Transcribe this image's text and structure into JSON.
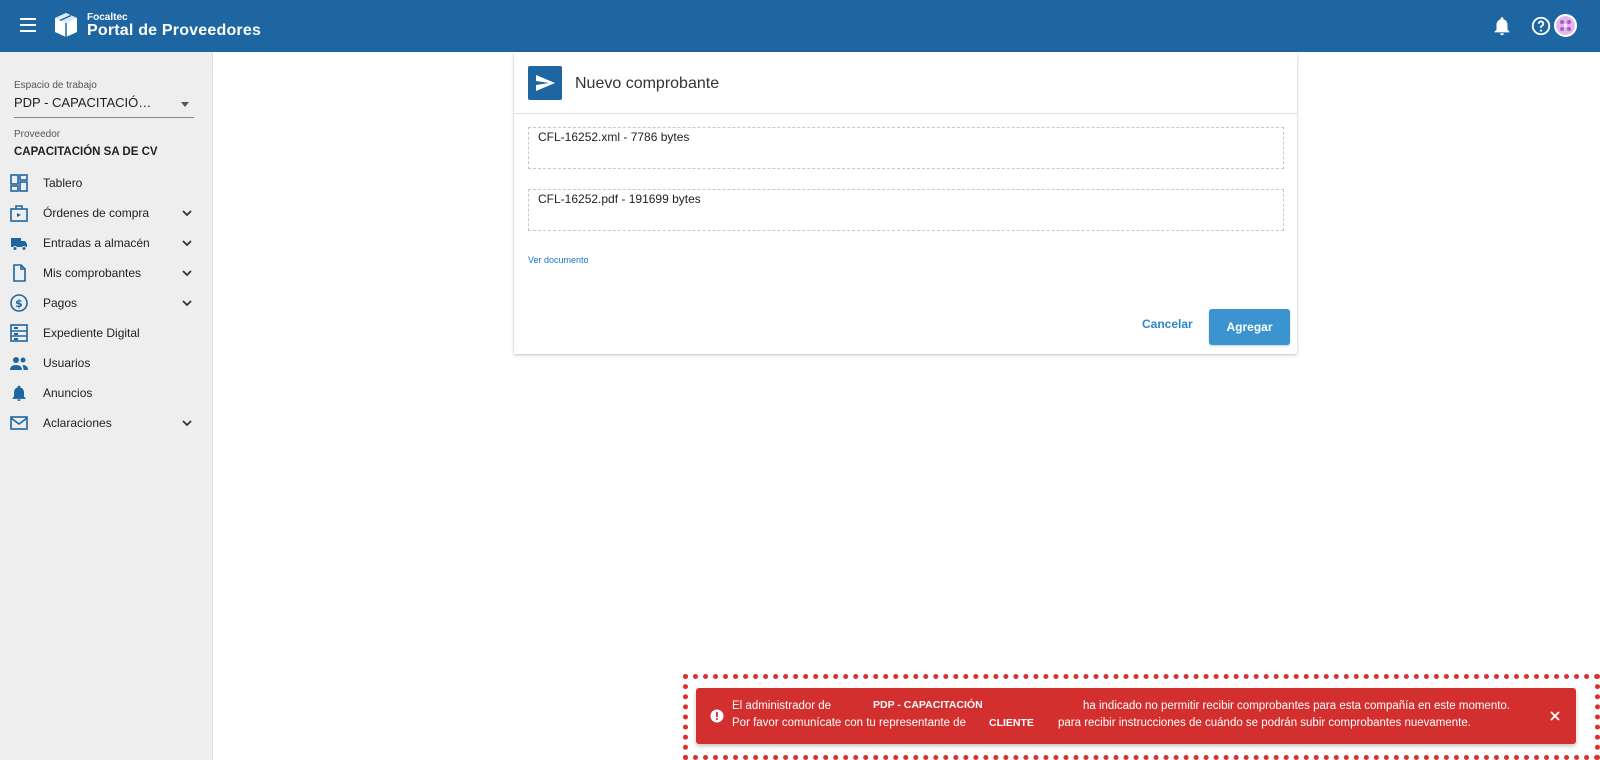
{
  "header": {
    "brand_small": "Focaltec",
    "brand_title": "Portal de Proveedores",
    "icons": [
      "menu-icon",
      "logo-icon",
      "bell-icon",
      "help-icon",
      "avatar"
    ],
    "color": "#1e66a1"
  },
  "sidebar": {
    "workspace_label": "Espacio de trabajo",
    "workspace_value": "PDP - CAPACITACIÓ…",
    "provider_label": "Proveedor",
    "provider_value": "CAPACITACIÓN SA DE CV",
    "items": [
      {
        "label": "Tablero",
        "icon": "dashboard-icon",
        "expandable": false
      },
      {
        "label": "Órdenes de compra",
        "icon": "orders-icon",
        "expandable": true
      },
      {
        "label": "Entradas a almacén",
        "icon": "truck-icon",
        "expandable": true
      },
      {
        "label": "Mis comprobantes",
        "icon": "document-icon",
        "expandable": true
      },
      {
        "label": "Pagos",
        "icon": "dollar-icon",
        "expandable": true
      },
      {
        "label": "Expediente Digital",
        "icon": "folder-icon",
        "expandable": false
      },
      {
        "label": "Usuarios",
        "icon": "users-icon",
        "expandable": false
      },
      {
        "label": "Anuncios",
        "icon": "bell-icon",
        "expandable": false
      },
      {
        "label": "Aclaraciones",
        "icon": "mail-icon",
        "expandable": true
      }
    ]
  },
  "dialog": {
    "title": "Nuevo comprobante",
    "files": [
      "CFL-16252.xml - 7786 bytes",
      "CFL-16252.pdf - 191699 bytes"
    ],
    "view_document": "Ver documento",
    "cancel": "Cancelar",
    "add": "Agregar"
  },
  "snackbar": {
    "line1_prefix": "El administrador de",
    "line1_bold": "PDP - CAPACITACIÓN",
    "line1_suffix": "ha indicado no permitir recibir comprobantes para esta compañía en este momento.",
    "line2_prefix": "Por favor comunícate con tu representante de",
    "line2_bold": "CLIENTE",
    "line2_suffix": "para recibir instrucciones de cuándo se podrán subir comprobantes nuevamente.",
    "color": "#d32f2f"
  }
}
